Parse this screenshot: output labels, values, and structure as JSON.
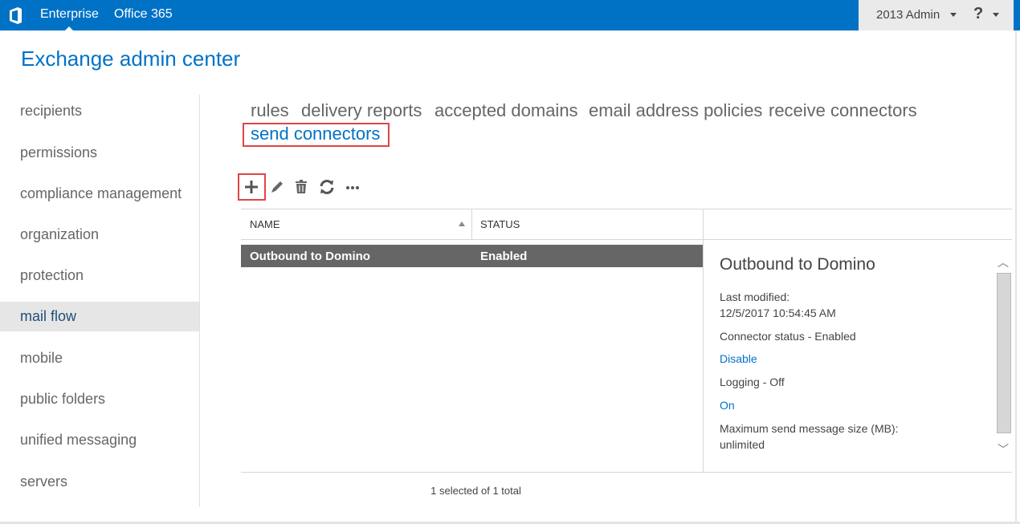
{
  "topbar": {
    "links": [
      "Enterprise",
      "Office 365"
    ],
    "user": "2013 Admin",
    "help": "?"
  },
  "title": "Exchange admin center",
  "sidebar": {
    "items": [
      "recipients",
      "permissions",
      "compliance management",
      "organization",
      "protection",
      "mail flow",
      "mobile",
      "public folders",
      "unified messaging",
      "servers"
    ],
    "active": "mail flow"
  },
  "tabs": [
    "rules",
    "delivery reports",
    "accepted domains",
    "email address policies",
    "receive connectors",
    "send connectors"
  ],
  "active_tab": "send connectors",
  "toolbar": {
    "icons": [
      "plus-icon",
      "pencil-icon",
      "trash-icon",
      "refresh-icon",
      "more-icon"
    ]
  },
  "table": {
    "columns": [
      "NAME",
      "STATUS"
    ],
    "rows": [
      {
        "name": "Outbound to Domino",
        "status": "Enabled"
      }
    ]
  },
  "detail": {
    "title": "Outbound to Domino",
    "last_modified_label": "Last modified:",
    "last_modified": "12/5/2017 10:54:45 AM",
    "status": "Connector status - Enabled",
    "disable_link": "Disable",
    "logging": "Logging - Off",
    "on_link": "On",
    "max_size_label": "Maximum send message size (MB):",
    "max_size": "unlimited"
  },
  "footer": "1 selected of 1 total",
  "colors": {
    "brand": "#0072c6",
    "highlight": "#e04545",
    "selected_row": "#666666"
  }
}
